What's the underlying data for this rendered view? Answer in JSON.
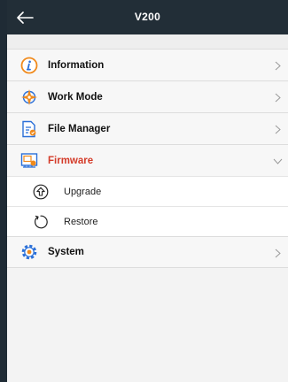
{
  "header": {
    "title": "V200",
    "back_icon": "arrow-left-icon"
  },
  "menu": {
    "items": [
      {
        "label": "Information",
        "icon": "info-icon",
        "color": "#f08a1c"
      },
      {
        "label": "Work Mode",
        "icon": "compass-icon",
        "color": "#f08a1c"
      },
      {
        "label": "File Manager",
        "icon": "file-manager-icon",
        "color": "#f08a1c"
      },
      {
        "label": "Firmware",
        "icon": "firmware-icon",
        "color": "#d43c2a",
        "expanded": true
      },
      {
        "label": "System",
        "icon": "gear-icon",
        "color": "#f08a1c"
      }
    ],
    "firmware_sub": [
      {
        "label": "Upgrade",
        "icon": "upgrade-icon"
      },
      {
        "label": "Restore",
        "icon": "restore-icon"
      }
    ]
  },
  "colors": {
    "header_bg": "#222e37",
    "accent_orange": "#f08a1c",
    "accent_blue": "#2a6fd8",
    "active_red": "#d43c2a"
  }
}
